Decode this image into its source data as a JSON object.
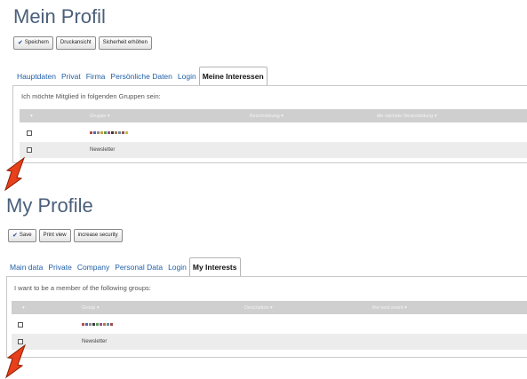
{
  "german": {
    "title": "Mein Profil",
    "buttons": {
      "save": "Speichern",
      "print": "Druckansicht",
      "security": "Sicherheit erhöhen"
    },
    "tabs": [
      "Hauptdaten",
      "Privat",
      "Firma",
      "Persönliche Daten",
      "Login",
      "Meine Interessen"
    ],
    "active_tab": "Meine Interessen",
    "intro": "Ich möchte Mitglied in folgenden Gruppen sein:",
    "columns": {
      "sort": "",
      "group": "Gruppe",
      "description": "Beschreibung",
      "next_event": "die nächste Veranstaltung"
    },
    "rows": [
      {
        "group": "",
        "redacted": true
      },
      {
        "group": "Newsletter",
        "redacted": false
      }
    ]
  },
  "english": {
    "title": "My Profile",
    "buttons": {
      "save": "Save",
      "print": "Print view",
      "security": "increase security"
    },
    "tabs": [
      "Main data",
      "Private",
      "Company",
      "Personal Data",
      "Login",
      "My Interests"
    ],
    "active_tab": "My Interests",
    "intro": "I want to be a member of the following groups:",
    "columns": {
      "sort": "",
      "group": "Group",
      "description": "Description",
      "next_event": "the next event"
    },
    "rows": [
      {
        "group": "",
        "redacted": true
      },
      {
        "group": "Newsletter",
        "redacted": false
      }
    ]
  },
  "icons": {
    "sort_arrow": "▾",
    "save_check": "✔",
    "annotation": "red-arrow"
  },
  "colors": {
    "title": "#4a5f7a",
    "link": "#1f5fa8",
    "header_bg": "#cfcfcf",
    "arrow": "#e8401c"
  }
}
